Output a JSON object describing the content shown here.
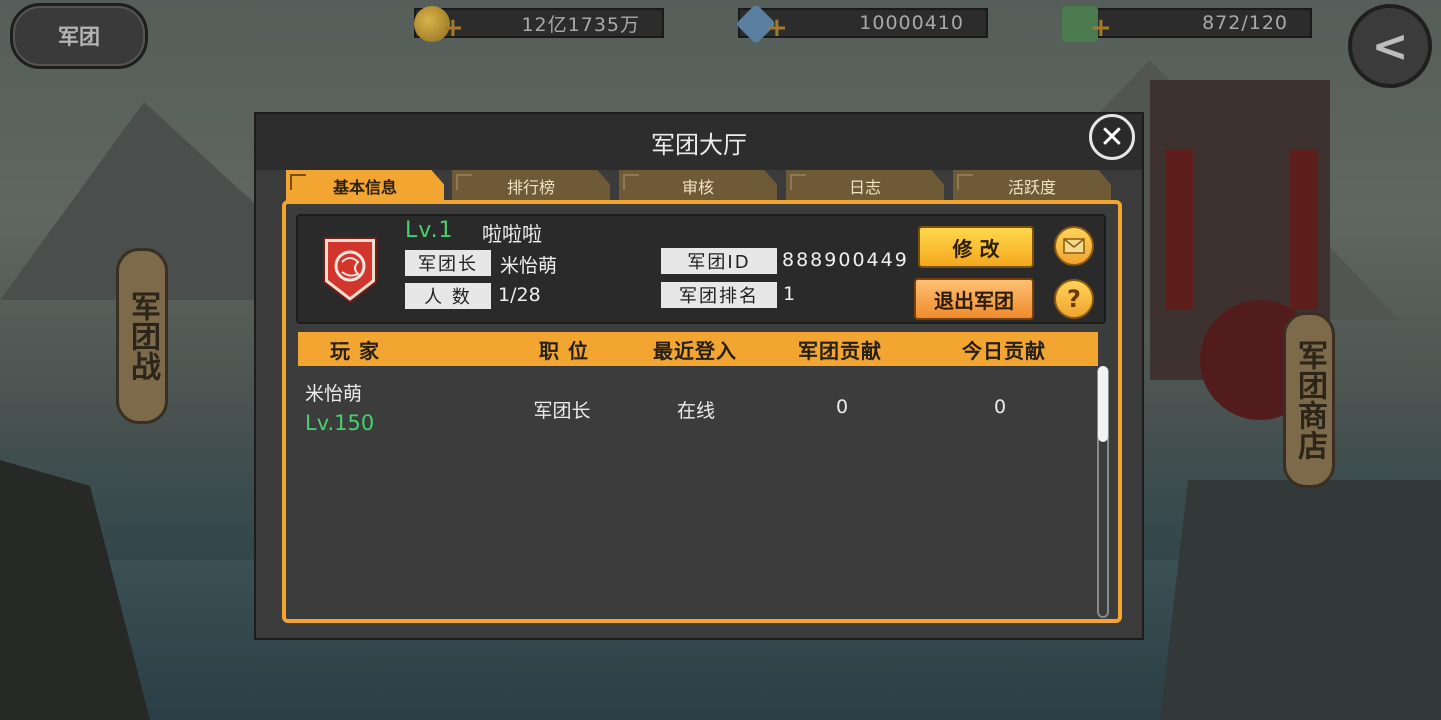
{
  "hud": {
    "guild_button": "军团",
    "gold": "12亿1735万",
    "diamond": "10000410",
    "stamina": "872/120"
  },
  "side": {
    "left_entry": "军团战",
    "right_entry": "军团商店"
  },
  "dialog": {
    "title": "军团大厅",
    "tabs": [
      "基本信息",
      "排行榜",
      "审核",
      "日志",
      "活跃度"
    ],
    "active_tab": 0
  },
  "guild": {
    "level": "Lv.1",
    "name": "啦啦啦",
    "leader_label": "军团长",
    "leader_value": "米怡萌",
    "members_label": "人 数",
    "members_value": "1/28",
    "id_label": "军团ID",
    "id_value": "888900449",
    "rank_label": "军团排名",
    "rank_value": "1",
    "edit_button": "修 改",
    "quit_button": "退出军团",
    "help_symbol": "?"
  },
  "table": {
    "headers": [
      "玩 家",
      "职 位",
      "最近登入",
      "军团贡献",
      "今日贡献"
    ],
    "rows": [
      {
        "name": "米怡萌",
        "level": "Lv.150",
        "role": "军团长",
        "last_login": "在线",
        "total_contribution": "0",
        "today_contribution": "0"
      }
    ]
  },
  "colors": {
    "accent": "#f3a532",
    "level_green": "#47d06e",
    "panel_dark": "#3b3b3b"
  },
  "icons": [
    "gold-coin-icon",
    "diamond-icon",
    "stamina-icon",
    "back-arrow-icon",
    "close-icon",
    "mail-icon",
    "help-icon",
    "guild-emblem-icon"
  ]
}
